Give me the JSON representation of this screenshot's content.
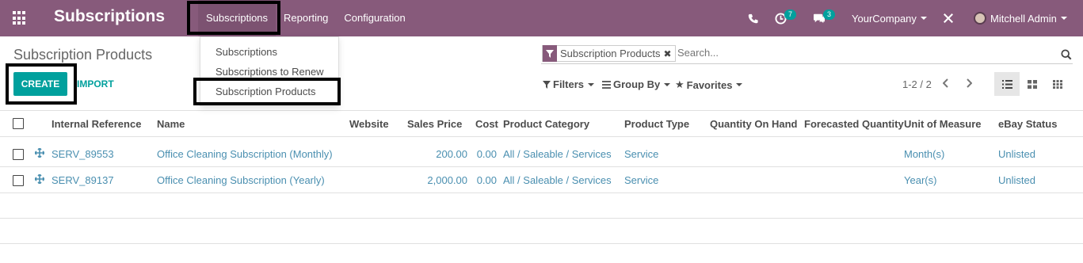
{
  "navbar": {
    "app_title": "Subscriptions",
    "menu": [
      "Subscriptions",
      "Reporting",
      "Configuration"
    ],
    "activity_count": "7",
    "message_count": "3",
    "company": "YourCompany",
    "user": "Mitchell Admin"
  },
  "dropdown": {
    "items": [
      "Subscriptions",
      "Subscriptions to Renew",
      "Subscription Products"
    ]
  },
  "control_panel": {
    "breadcrumb": "Subscription Products",
    "create_label": "CREATE",
    "import_label": "IMPORT",
    "facet_label": "Subscription Products",
    "facet_close": "✖",
    "search_placeholder": "Search...",
    "filters_label": "Filters",
    "groupby_label": "Group By",
    "favorites_label": "Favorites",
    "pager": "1-2 / 2"
  },
  "table": {
    "columns": [
      "Internal Reference",
      "Name",
      "Website",
      "Sales Price",
      "Cost",
      "Product Category",
      "Product Type",
      "Quantity On Hand",
      "Forecasted Quantity",
      "Unit of Measure",
      "eBay Status"
    ],
    "rows": [
      {
        "ref": "SERV_89553",
        "name": "Office Cleaning Subscription (Monthly)",
        "price": "200.00",
        "cost": "0.00",
        "category": "All / Saleable / Services",
        "type": "Service",
        "uom": "Month(s)",
        "ebay": "Unlisted"
      },
      {
        "ref": "SERV_89137",
        "name": "Office Cleaning Subscription (Yearly)",
        "price": "2,000.00",
        "cost": "0.00",
        "category": "All / Saleable / Services",
        "type": "Service",
        "uom": "Year(s)",
        "ebay": "Unlisted"
      }
    ]
  },
  "colors": {
    "brand": "#875a7b",
    "accent": "#00a09d",
    "link": "#4a8fb0"
  }
}
